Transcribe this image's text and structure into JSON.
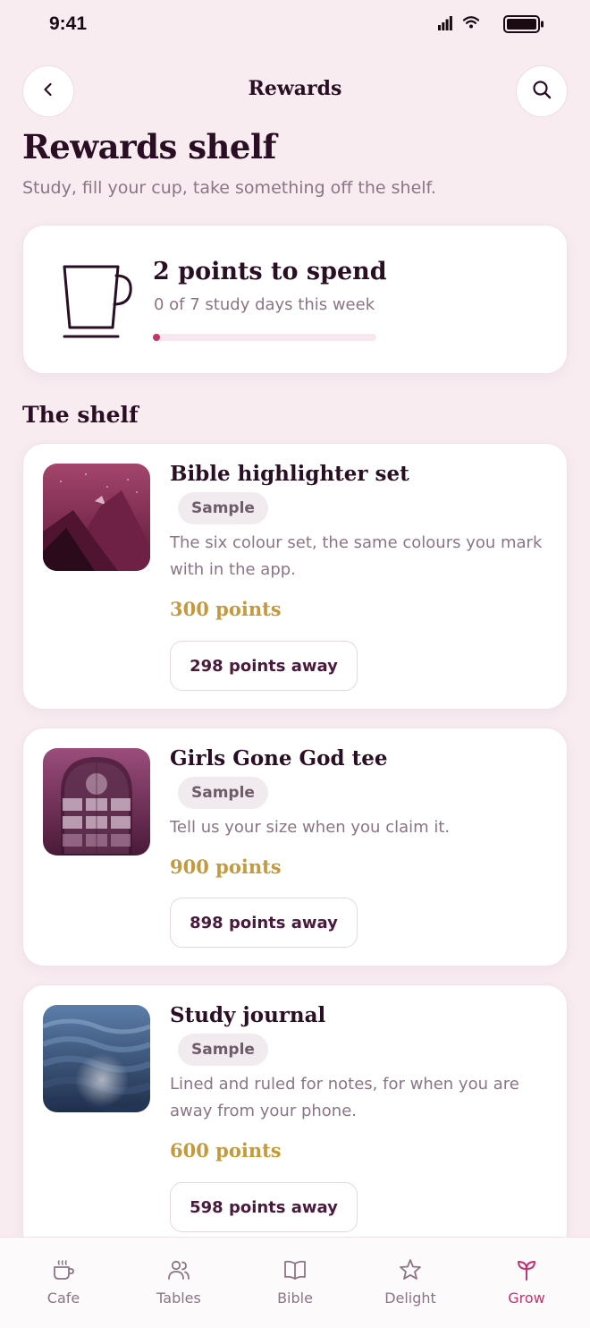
{
  "status_bar": {
    "time": "9:41"
  },
  "nav": {
    "title": "Rewards"
  },
  "header": {
    "title": "Rewards shelf",
    "subtitle": "Study, fill your cup, take something off the shelf."
  },
  "points": {
    "title": "2 points to spend",
    "subtitle": "0 of 7 study days this week",
    "progress_fraction": 0.0
  },
  "shelf": {
    "title": "The shelf",
    "items": [
      {
        "title": "Bible highlighter set",
        "badge": "Sample",
        "description": "The six colour set, the same colours you mark with in the app.",
        "cost": "300 points",
        "away": "298 points away",
        "thumb": "mountain-image"
      },
      {
        "title": "Girls Gone God tee",
        "badge": "Sample",
        "description": "Tell us your size when you claim it.",
        "cost": "900 points",
        "away": "898 points away",
        "thumb": "arched-window-image"
      },
      {
        "title": "Study journal",
        "badge": "Sample",
        "description": "Lined and ruled for notes, for when you are away from your phone.",
        "cost": "600 points",
        "away": "598 points away",
        "thumb": "waves-image"
      }
    ]
  },
  "tabs": [
    {
      "label": "Cafe",
      "icon": "coffee-cup-icon",
      "active": false
    },
    {
      "label": "Tables",
      "icon": "people-icon",
      "active": false
    },
    {
      "label": "Bible",
      "icon": "book-icon",
      "active": false
    },
    {
      "label": "Delight",
      "icon": "star-icon",
      "active": false
    },
    {
      "label": "Grow",
      "icon": "sprout-icon",
      "active": true
    }
  ],
  "colors": {
    "background": "#f8ecf1",
    "accent": "#c2336f",
    "cost_gold": "#c49a3e",
    "text_dark": "#2a0f24"
  }
}
